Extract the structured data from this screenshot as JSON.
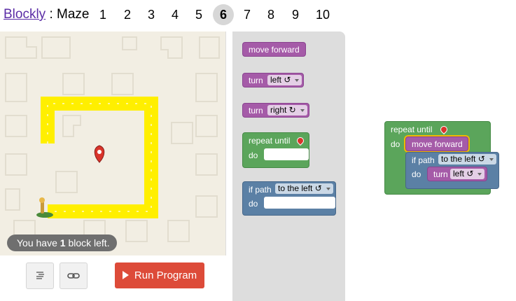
{
  "header": {
    "brand": "Blockly",
    "separator": " : ",
    "title": "Maze",
    "levels": [
      "1",
      "2",
      "3",
      "4",
      "5",
      "6",
      "7",
      "8",
      "9",
      "10"
    ],
    "active_level": "6"
  },
  "maze": {
    "status_prefix": "You have ",
    "status_count": "1",
    "status_suffix": " block left."
  },
  "toolbar": {
    "code_icon": "code-icon",
    "link_icon": "link-icon",
    "run_label": "Run Program"
  },
  "toolbox": {
    "move_forward": "move forward",
    "turn_left_label": "turn",
    "turn_left_value": "left ↺",
    "turn_right_label": "turn",
    "turn_right_value": "right ↻",
    "repeat_label": "repeat until",
    "repeat_do": "do",
    "if_label": "if path",
    "if_value": "to the left ↺",
    "if_do": "do"
  },
  "workspace": {
    "repeat_label": "repeat until",
    "repeat_do": "do",
    "move_forward": "move forward",
    "if_label": "if path",
    "if_value": "to the left ↺",
    "if_do": "do",
    "turn_label": "turn",
    "turn_value": "left ↺"
  },
  "colors": {
    "motion": "#a55ba8",
    "loop": "#5ba55b",
    "logic": "#5b80a5",
    "run": "#dd4b39",
    "path": "#ffff00"
  }
}
